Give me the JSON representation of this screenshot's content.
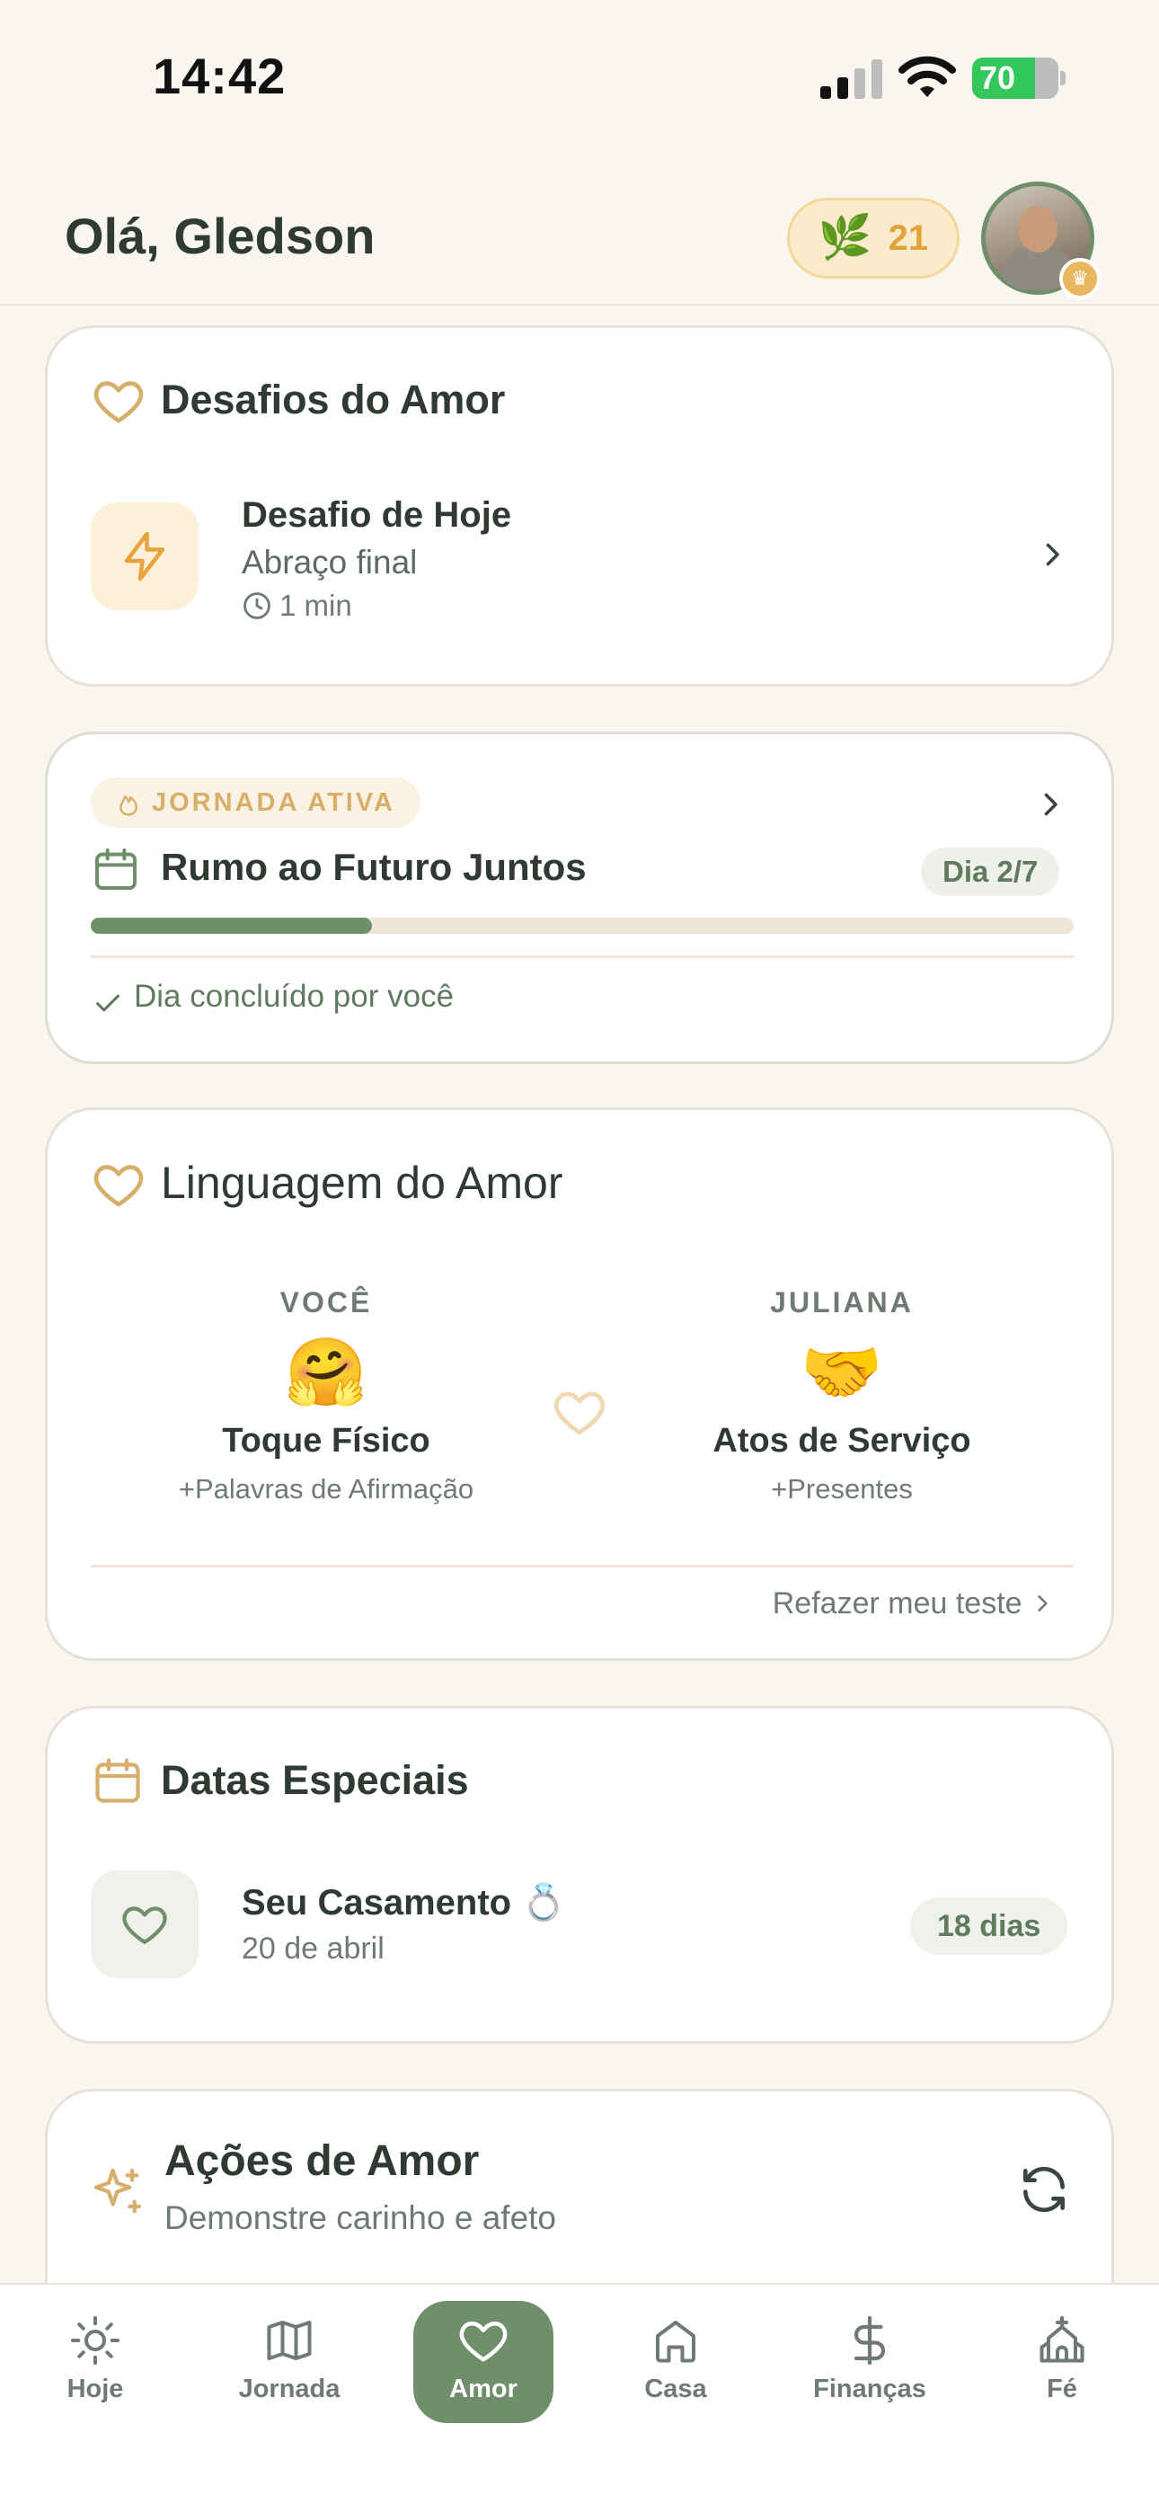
{
  "status_bar": {
    "time": "14:42",
    "battery": "70"
  },
  "header": {
    "greeting": "Olá, Gledson",
    "points": "21"
  },
  "challenge_card": {
    "title": "Desafios do Amor",
    "item_title": "Desafio de Hoje",
    "item_subtitle": "Abraço final",
    "item_duration": "1 min"
  },
  "journey_card": {
    "badge": "JORNADA ATIVA",
    "title": "Rumo ao Futuro Juntos",
    "day": "Dia 2/7",
    "progress": 0.2857,
    "status": "Dia concluído por você"
  },
  "love_language_card": {
    "title": "Linguagem do Amor",
    "me": {
      "label": "VOCÊ",
      "emoji": "🤗",
      "primary": "Toque Físico",
      "secondary": "+Palavras de Afirmação"
    },
    "partner": {
      "label": "JULIANA",
      "emoji": "🤝",
      "primary": "Atos de Serviço",
      "secondary": "+Presentes"
    },
    "retake": "Refazer meu teste"
  },
  "dates_card": {
    "title": "Datas Especiais",
    "event_title": "Seu Casamento 💍",
    "event_date": "20 de abril",
    "countdown": "18 dias"
  },
  "actions_card": {
    "title": "Ações de Amor",
    "subtitle": "Demonstre carinho e afeto"
  },
  "tabs": [
    {
      "label": "Hoje",
      "icon": "sun-icon"
    },
    {
      "label": "Jornada",
      "icon": "map-icon"
    },
    {
      "label": "Amor",
      "icon": "heart-icon",
      "active": true
    },
    {
      "label": "Casa",
      "icon": "house-icon"
    },
    {
      "label": "Finanças",
      "icon": "dollar-icon"
    },
    {
      "label": "Fé",
      "icon": "church-icon"
    }
  ],
  "colors": {
    "background": "#F9F6F0",
    "accent_green": "#6F8F6B",
    "accent_gold": "#D7AE6A",
    "text_dark": "#2F3A33"
  }
}
